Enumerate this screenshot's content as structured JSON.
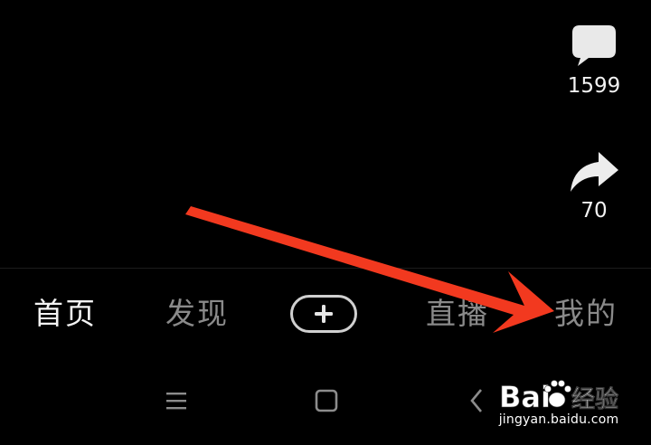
{
  "actions": {
    "comment_count": "1599",
    "share_count": "70"
  },
  "tabs": [
    {
      "label": "首页",
      "active": true
    },
    {
      "label": "发现",
      "active": false
    },
    {
      "label": "直播",
      "active": false
    },
    {
      "label": "我的",
      "active": false
    }
  ],
  "create_button": {
    "icon": "plus-icon"
  },
  "system_nav": {
    "icons": [
      "menu-lines-icon",
      "home-square-icon",
      "back-chevron-icon"
    ]
  },
  "annotation": {
    "color": "#f2391f",
    "points_to": "我的"
  },
  "watermark": {
    "logo_text": "Bai 经验",
    "url": "jingyan.baidu.com"
  },
  "colors": {
    "background": "#000000",
    "active_tab": "#f4f4f4",
    "inactive_tab": "#8a8a8a",
    "arrow": "#f2391f"
  }
}
